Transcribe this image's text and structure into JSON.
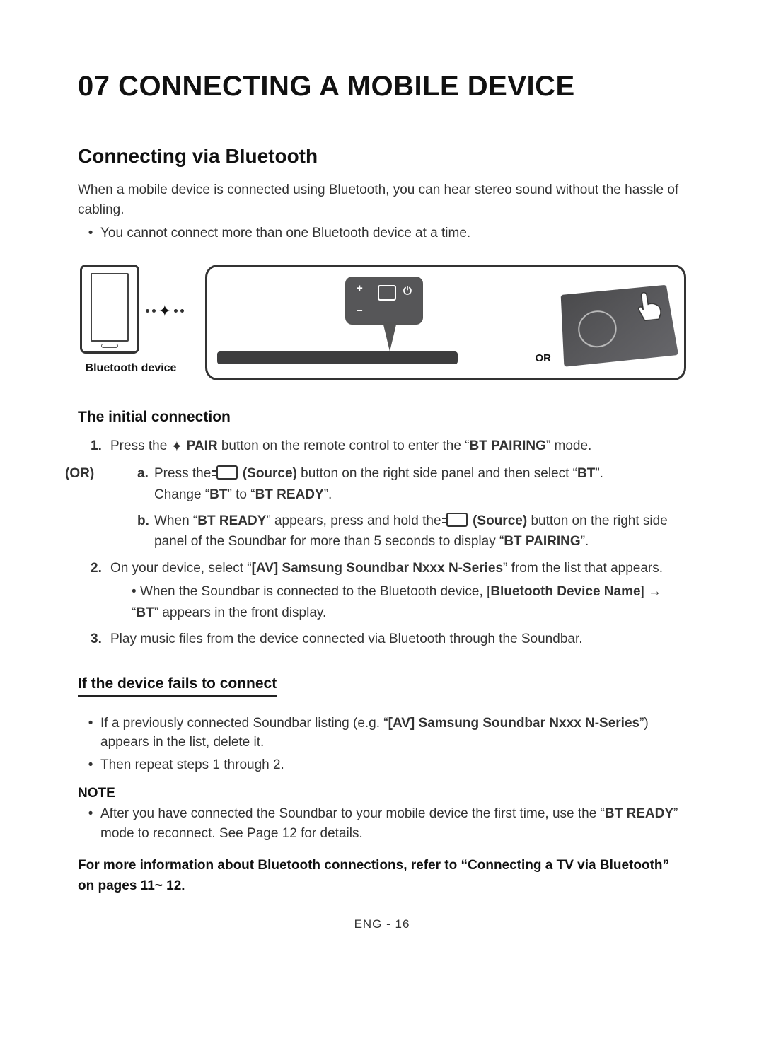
{
  "chapter": "07 CONNECTING A MOBILE DEVICE",
  "section1": {
    "title": "Connecting via Bluetooth",
    "intro": "When a mobile device is connected using Bluetooth, you can hear stereo sound without the hassle of cabling.",
    "bullet1": "You cannot connect more than one Bluetooth device at a time."
  },
  "diagram": {
    "bt_device_label": "Bluetooth device",
    "or_label": "OR"
  },
  "initial": {
    "heading": "The initial connection",
    "step1_pre": "Press the ",
    "step1_pair": " PAIR",
    "step1_post": " button on the remote control to enter the “",
    "step1_mode": "BT PAIRING",
    "step1_end": "” mode.",
    "or": "(OR)",
    "a_pre": "Press the ",
    "a_source": " (Source)",
    "a_mid": " button on the right side panel and then select “",
    "a_bt": "BT",
    "a_end": "”.",
    "a_line2_pre": "Change “",
    "a_line2_bt": "BT",
    "a_line2_mid": "” to “",
    "a_line2_ready": "BT READY",
    "a_line2_end": "”.",
    "b_pre": "When “",
    "b_ready": "BT READY",
    "b_mid": "” appears, press and hold the ",
    "b_source": " (Source)",
    "b_mid2": " button on the right side panel of the Soundbar for more than 5 seconds to display “",
    "b_pairing": "BT PAIRING",
    "b_end": "”.",
    "step2_pre": "On your device, select “",
    "step2_name": "[AV] Samsung Soundbar Nxxx N-Series",
    "step2_post": "” from the list that appears.",
    "step2_sub_pre": "When the Soundbar is connected to the Bluetooth device, [",
    "step2_sub_name": "Bluetooth Device Name",
    "step2_sub_mid": "] → “",
    "step2_sub_bt": "BT",
    "step2_sub_end": "” appears in the front display.",
    "step3": "Play music files from the device connected via Bluetooth through the Soundbar."
  },
  "fails": {
    "heading": "If the device fails to connect",
    "b1_pre": "If a previously connected Soundbar listing (e.g. “",
    "b1_name": "[AV] Samsung Soundbar Nxxx N-Series",
    "b1_post": "”) appears in the list, delete it.",
    "b2": "Then repeat steps 1 through 2."
  },
  "note": {
    "head": "NOTE",
    "text_pre": "After you have connected the Soundbar to your mobile device the first time, use the “",
    "text_ready": "BT READY",
    "text_post": "” mode to reconnect. See Page 12 for details."
  },
  "more_info": "For more information about Bluetooth connections, refer to “Connecting a TV via Bluetooth” on pages 11~ 12.",
  "footer": "ENG - 16"
}
